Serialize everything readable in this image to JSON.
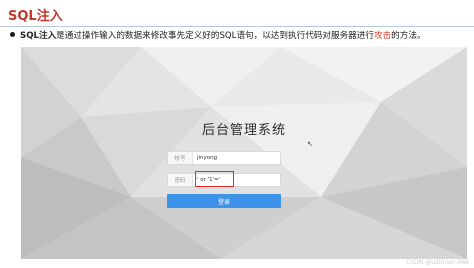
{
  "slide": {
    "title": "SQL注入",
    "bullet": {
      "term": "SQL注入",
      "text_before": "是通过操作输入的数据来修改事先定义好的SQL语句，以达到执行代码对服务器进行",
      "highlight": "攻击",
      "text_after": "的方法。"
    }
  },
  "login": {
    "title": "后台管理系统",
    "username_label": "帐号",
    "username_value": "jinyong",
    "password_label": "密码",
    "password_value": "' or '1'='",
    "submit_label": "登录"
  },
  "colors": {
    "title_red": "#c0392b",
    "highlight_red": "#d43b2a",
    "button_blue": "#3d92ea",
    "injection_box_red": "#e02b2b"
  },
  "icons": {
    "bullet": "bullet-dot",
    "cursor": "mouse-pointer-icon"
  },
  "watermark": "CSDN @Ustinian.488"
}
